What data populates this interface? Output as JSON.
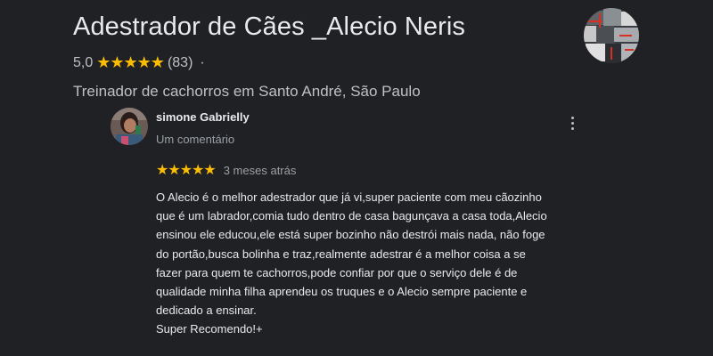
{
  "business": {
    "name": "Adestrador de Cães _Alecio Neris",
    "rating_value": "5,0",
    "stars": "★★★★★",
    "review_count": "(83)",
    "separator": "·",
    "category": "Treinador de cachorros em Santo André, São Paulo"
  },
  "review": {
    "author": "simone Gabrielly",
    "author_meta": "Um comentário",
    "stars": "★★★★★",
    "rating": 5,
    "date": "3 meses atrás",
    "text_lines": [
      "O Alecio é o melhor adestrador que já vi,super paciente com meu cãozinho",
      "que é um labrador,comia tudo dentro de casa bagunçava a casa toda,Alecio",
      "ensinou ele educou,ele está super bozinho não destrói mais nada, não foge",
      "do portão,busca bolinha e traz,realmente adestrar é a melhor coisa a se",
      "fazer para quem te cachorros,pode confiar por que o serviço dele é de",
      "qualidade minha filha aprendeu os truques e o Alecio sempre paciente e",
      "dedicado a ensinar.",
      "Super Recomendo!+"
    ]
  },
  "icons": {
    "more": "more-vert-icon",
    "star": "star-icon"
  },
  "colors": {
    "background": "#202124",
    "star": "#fbbc04",
    "text_primary": "#e8eaed",
    "text_secondary": "#bdc1c6"
  }
}
